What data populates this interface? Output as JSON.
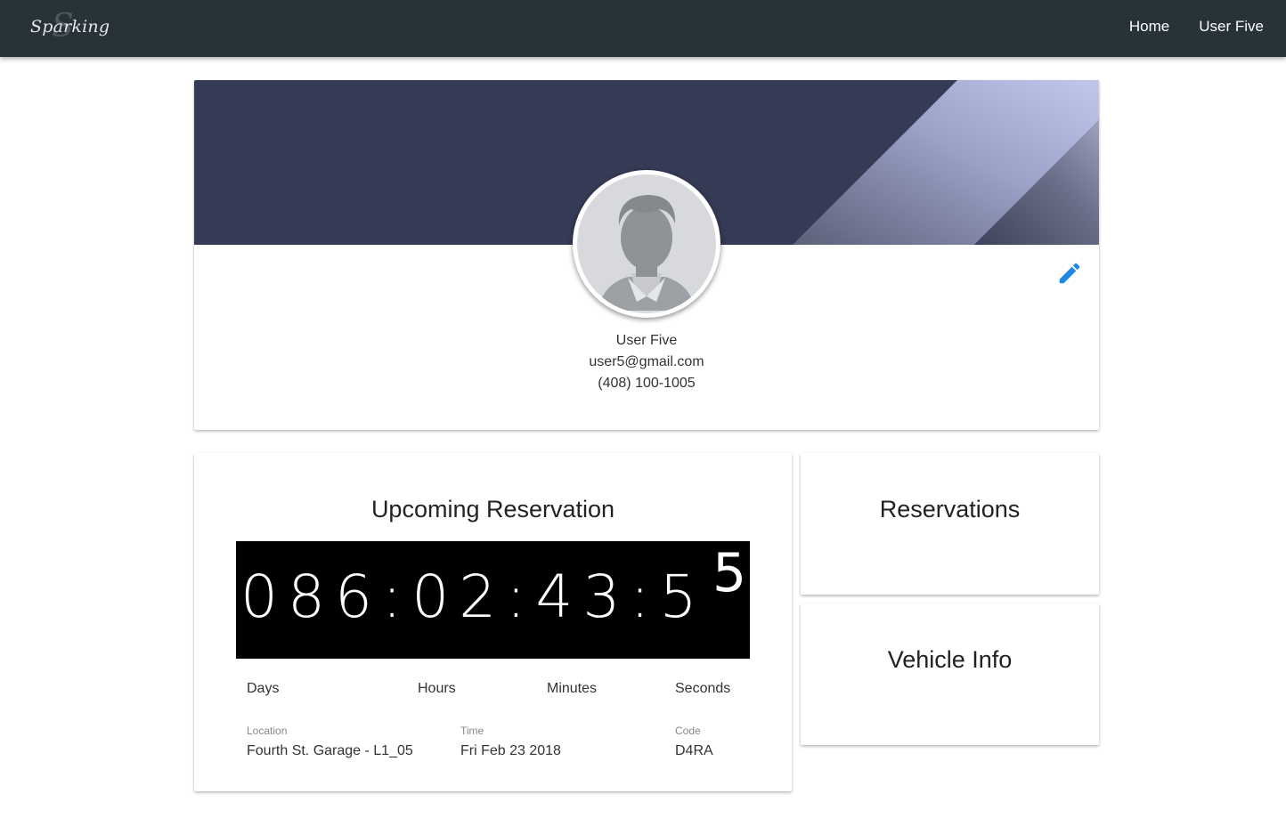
{
  "navbar": {
    "brand": "Sparking",
    "brand_mark": "S",
    "links": [
      "Home",
      "User Five"
    ]
  },
  "profile": {
    "name": "User Five",
    "email": "user5@gmail.com",
    "phone": "(408) 100-1005",
    "avatar_icon": "default-user-silhouette-icon",
    "edit_icon": "pencil-icon",
    "accent_color": "#1e88e5",
    "banner_color": "#353a55"
  },
  "upcoming": {
    "title": "Upcoming Reservation",
    "countdown": "086:02:43:5",
    "countdown_last_digit": "5",
    "units": [
      "Days",
      "Hours",
      "Minutes",
      "Seconds"
    ],
    "details": {
      "location_label": "Location",
      "location": "Fourth St. Garage - L1_05",
      "time_label": "Time",
      "time": "Fri Feb 23 2018",
      "code_label": "Code",
      "code": "D4RA"
    }
  },
  "reservations": {
    "title": "Reservations"
  },
  "vehicle": {
    "title": "Vehicle Info"
  }
}
